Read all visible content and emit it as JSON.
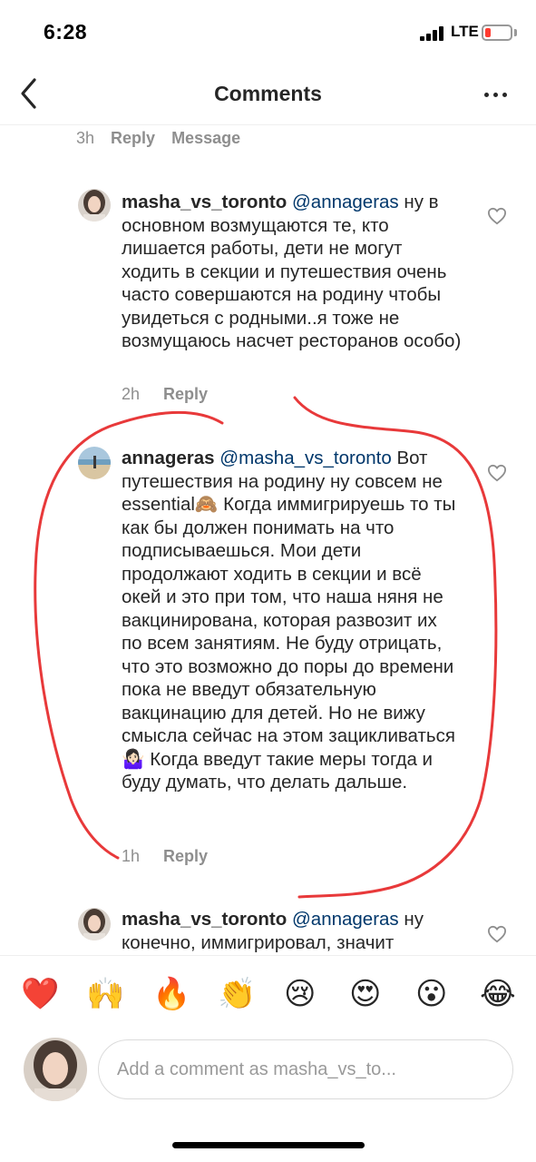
{
  "status_bar": {
    "time": "6:28",
    "network": "LTE"
  },
  "header": {
    "title": "Comments"
  },
  "prev_comment_meta": {
    "time": "3h",
    "reply": "Reply",
    "message": "Message"
  },
  "comments": [
    {
      "username": "masha_vs_toronto",
      "mention": "@annageras",
      "text": "ну в основном возмущаются те, кто лишается работы, дети не могут ходить в секции и путешествия очень часто совершаются на родину чтобы увидеться с родными..я тоже не возмущаюсь насчет ресторанов особо)",
      "time": "2h",
      "reply": "Reply"
    },
    {
      "username": "annageras",
      "mention": "@masha_vs_toronto",
      "text_part1": "Вот путешествия на родину ну совсем не essential",
      "emoji1": "🙈",
      "text_part2": " Когда иммигрируешь то ты как бы должен понимать на что подписываешься. Мои дети продолжают ходить в секции и всё окей и это при том, что наша няня не вакцинирована, которая развозит их по всем занятиям. Не буду отрицать, что это возможно до поры до времени пока не введут обязательную вакцинацию для детей. Но не вижу смысла сейчас на этом зацикливаться",
      "emoji2": "🤷🏻‍♀️",
      "text_part3": " Когда введут такие меры тогда и буду думать, что делать дальше.",
      "time": "1h",
      "reply": "Reply"
    },
    {
      "username": "masha_vs_toronto",
      "mention": "@annageras",
      "text": "ну конечно, иммигрировал, значит"
    }
  ],
  "emoji_bar": [
    "❤️",
    "🙌",
    "🔥",
    "👏",
    "😢",
    "😍",
    "😮",
    "😂"
  ],
  "input": {
    "placeholder": "Add a comment as masha_vs_to..."
  },
  "colors": {
    "mention": "#00376b",
    "annotation": "#e8393a",
    "secondary_text": "#8e8e8e"
  }
}
